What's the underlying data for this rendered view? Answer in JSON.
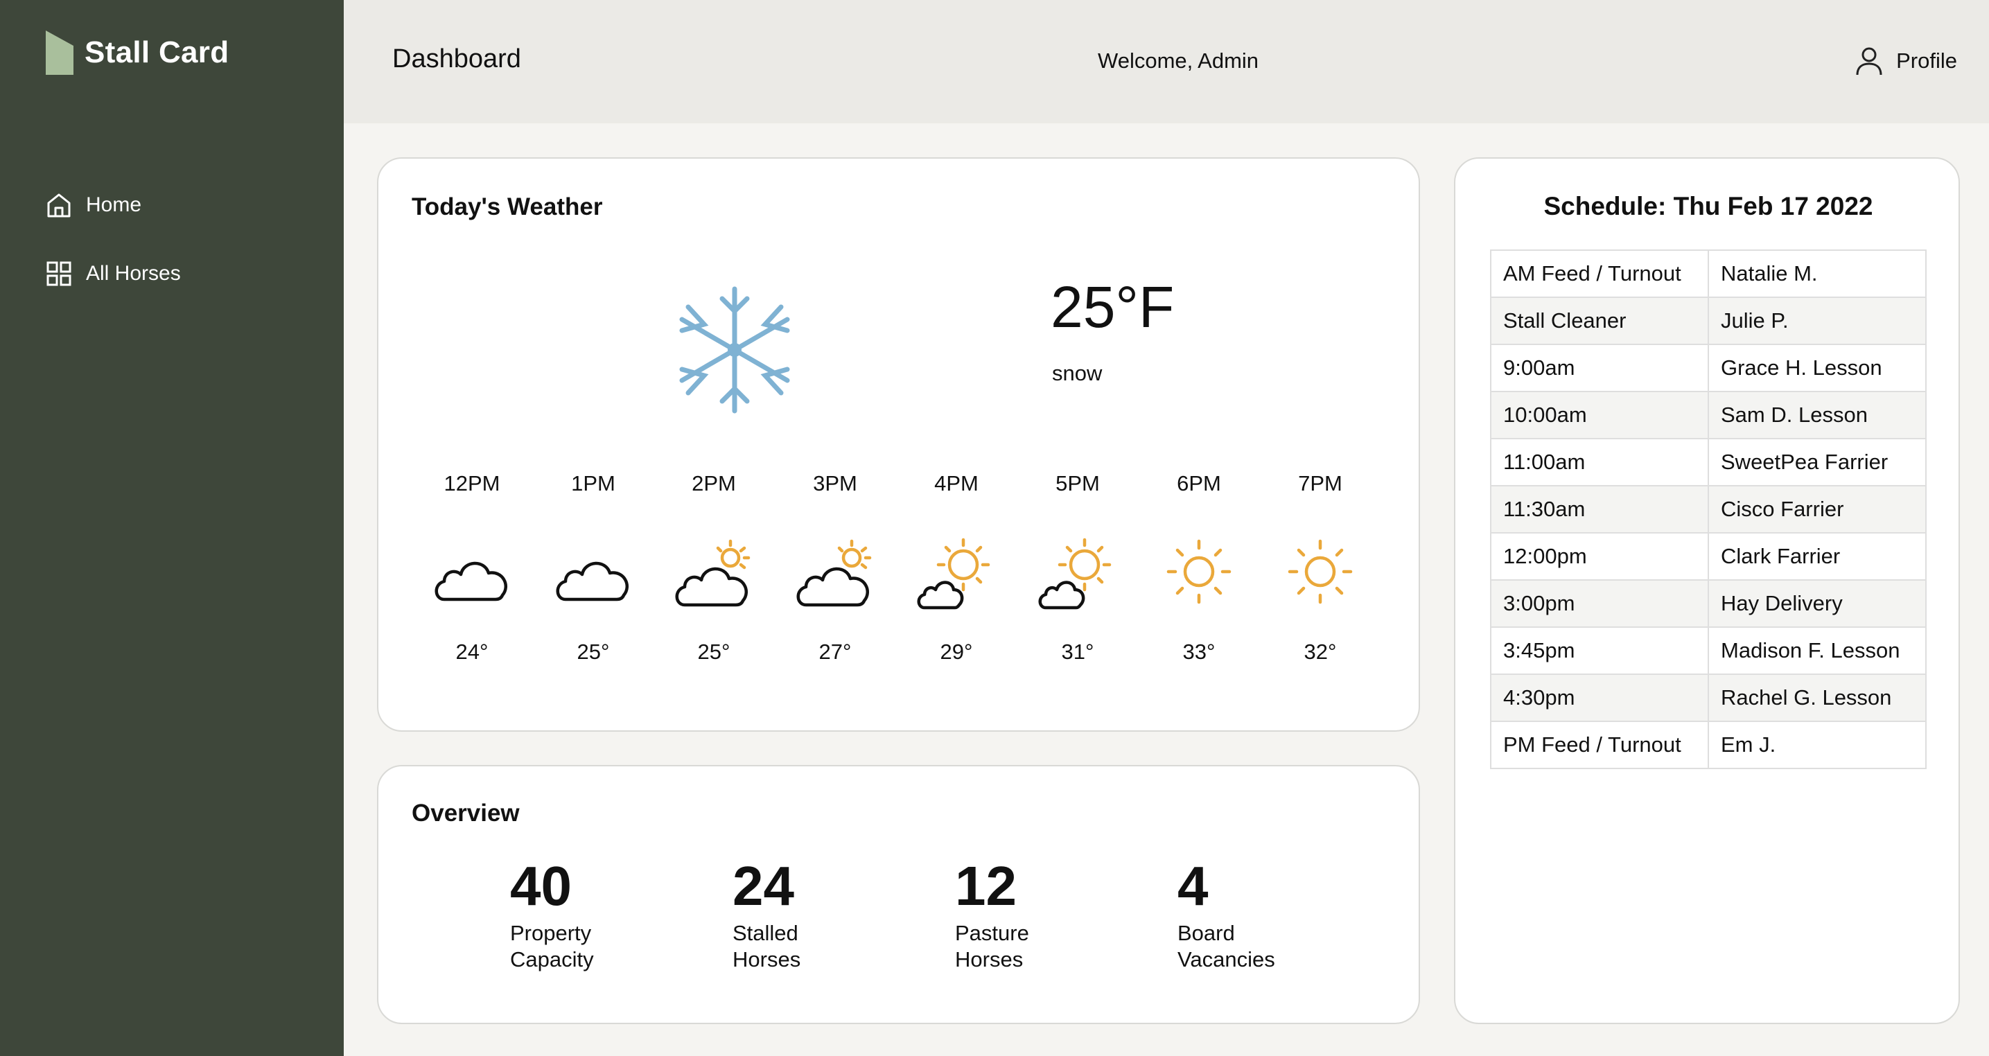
{
  "app": {
    "name": "Stall Card"
  },
  "sidebar": {
    "items": [
      {
        "label": "Home",
        "icon": "home-icon"
      },
      {
        "label": "All Horses",
        "icon": "grid-icon"
      }
    ]
  },
  "header": {
    "title": "Dashboard",
    "welcome": "Welcome, Admin",
    "profile_label": "Profile",
    "profile_icon": "user-icon"
  },
  "weather": {
    "title": "Today's Weather",
    "current": {
      "temp": "25°F",
      "condition": "snow",
      "icon": "snowflake-icon"
    },
    "hourly": [
      {
        "time": "12PM",
        "temp": "24°",
        "icon": "cloud-icon"
      },
      {
        "time": "1PM",
        "temp": "25°",
        "icon": "cloud-icon"
      },
      {
        "time": "2PM",
        "temp": "25°",
        "icon": "cloud-sun-icon"
      },
      {
        "time": "3PM",
        "temp": "27°",
        "icon": "cloud-sun-icon"
      },
      {
        "time": "4PM",
        "temp": "29°",
        "icon": "sun-cloud-icon"
      },
      {
        "time": "5PM",
        "temp": "31°",
        "icon": "sun-cloud-icon"
      },
      {
        "time": "6PM",
        "temp": "33°",
        "icon": "sun-icon"
      },
      {
        "time": "7PM",
        "temp": "32°",
        "icon": "sun-icon"
      }
    ]
  },
  "overview": {
    "title": "Overview",
    "stats": [
      {
        "value": "40",
        "label_line1": "Property",
        "label_line2": "Capacity"
      },
      {
        "value": "24",
        "label_line1": "Stalled",
        "label_line2": "Horses"
      },
      {
        "value": "12",
        "label_line1": "Pasture",
        "label_line2": "Horses"
      },
      {
        "value": "4",
        "label_line1": "Board",
        "label_line2": "Vacancies"
      }
    ]
  },
  "schedule": {
    "title": "Schedule: Thu Feb 17 2022",
    "rows": [
      [
        "AM Feed / Turnout",
        "Natalie M."
      ],
      [
        "Stall Cleaner",
        "Julie P."
      ],
      [
        "9:00am",
        "Grace H. Lesson"
      ],
      [
        "10:00am",
        "Sam D. Lesson"
      ],
      [
        "11:00am",
        "SweetPea Farrier"
      ],
      [
        "11:30am",
        "Cisco Farrier"
      ],
      [
        "12:00pm",
        "Clark Farrier"
      ],
      [
        "3:00pm",
        "Hay Delivery"
      ],
      [
        "3:45pm",
        "Madison F. Lesson"
      ],
      [
        "4:30pm",
        "Rachel G. Lesson"
      ],
      [
        "PM Feed / Turnout",
        "Em J."
      ]
    ]
  },
  "colors": {
    "sidebar": "#3e473a",
    "header": "#ebeae6",
    "page_bg": "#f5f4f1",
    "logo_accent": "#a9bf9c",
    "snow": "#7fb2d3",
    "sun": "#eaa83a"
  }
}
